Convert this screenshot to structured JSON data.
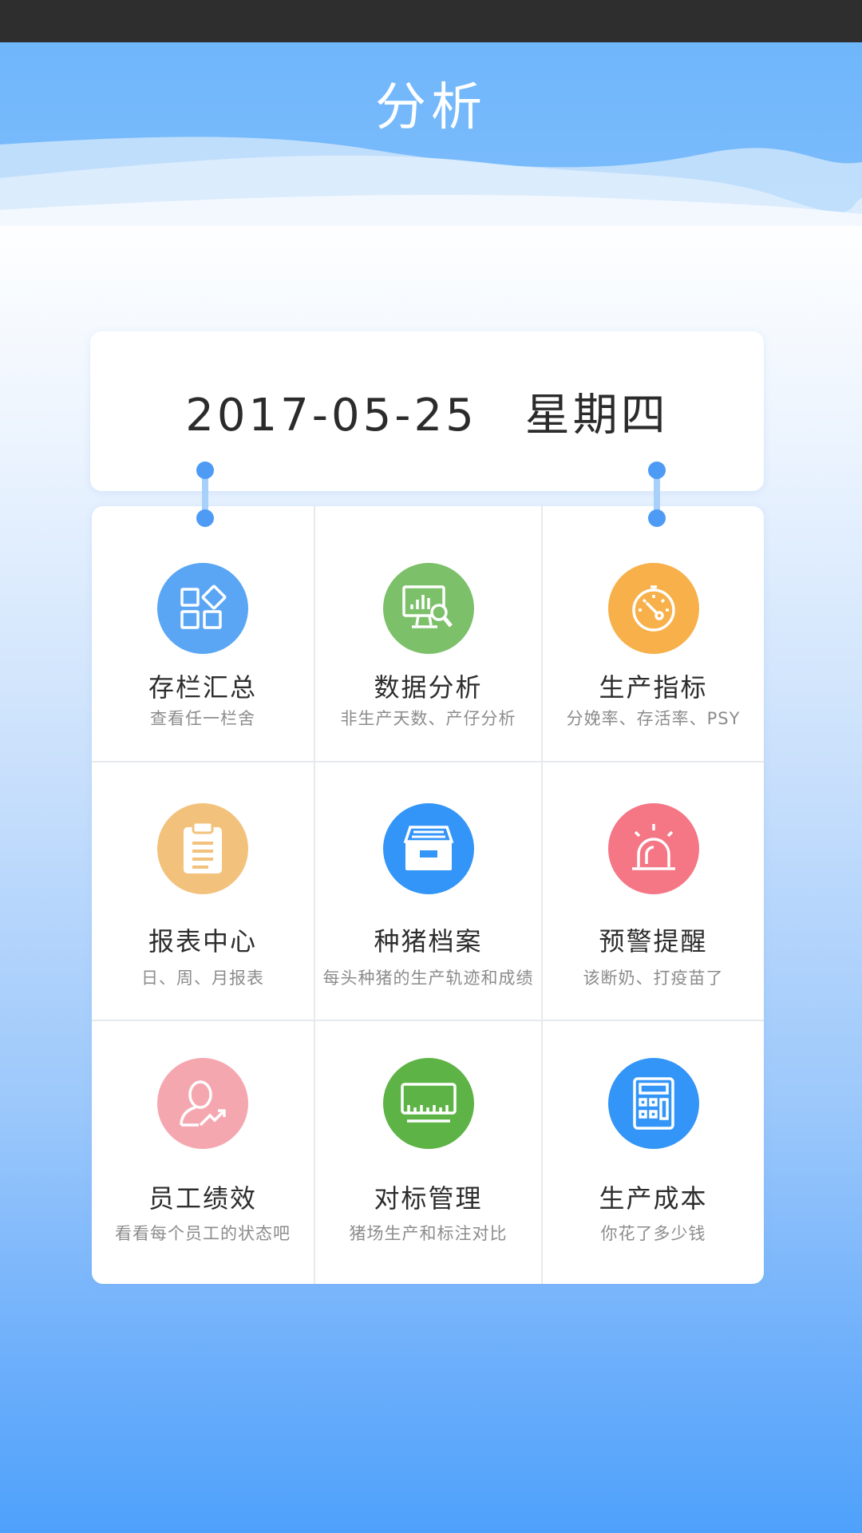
{
  "header": {
    "title": "分析"
  },
  "date": {
    "date": "2017-05-25",
    "weekday": "星期四"
  },
  "modules": [
    {
      "title": "存栏汇总",
      "subtitle": "查看任一栏舍",
      "icon": "apps-icon",
      "color": "#5aa6f4"
    },
    {
      "title": "数据分析",
      "subtitle": "非生产天数、产仔分析",
      "icon": "chart-search-icon",
      "color": "#7cc06a"
    },
    {
      "title": "生产指标",
      "subtitle": "分娩率、存活率、PSY",
      "icon": "gauge-icon",
      "color": "#f7b04a"
    },
    {
      "title": "报表中心",
      "subtitle": "日、周、月报表",
      "icon": "clipboard-icon",
      "color": "#f2c27c"
    },
    {
      "title": "种猪档案",
      "subtitle": "每头种猪的生产轨迹和成绩",
      "icon": "archive-icon",
      "color": "#3395f7"
    },
    {
      "title": "预警提醒",
      "subtitle": "该断奶、打疫苗了",
      "icon": "alarm-icon",
      "color": "#f57685"
    },
    {
      "title": "员工绩效",
      "subtitle": "看看每个员工的状态吧",
      "icon": "user-trend-icon",
      "color": "#f5a7b0"
    },
    {
      "title": "对标管理",
      "subtitle": "猪场生产和标注对比",
      "icon": "ruler-icon",
      "color": "#5db345"
    },
    {
      "title": "生产成本",
      "subtitle": "你花了多少钱",
      "icon": "calculator-icon",
      "color": "#3395f7"
    }
  ]
}
